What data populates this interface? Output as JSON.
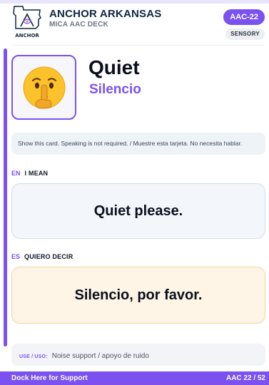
{
  "header": {
    "brand": "ANCHOR ARKANSAS",
    "deck": "MICA AAC DECK",
    "card_code": "AAC-22",
    "category": "SENSORY",
    "logo_text": "ANCHOR"
  },
  "card": {
    "emoji_icon": "shushing-face-icon",
    "title_en": "Quiet",
    "title_es": "Silencio",
    "instruction": "Show this card. Speaking is not required. / Muestre esta tarjeta. No necesita hablar."
  },
  "english": {
    "code": "EN",
    "heading": "I MEAN",
    "phrase": "Quiet please."
  },
  "spanish": {
    "code": "ES",
    "heading": "QUIERO DECIR",
    "phrase": "Silencio, por favor."
  },
  "use": {
    "label": "USE / USO:",
    "text": "Noise support / apoyo de ruido"
  },
  "footer": {
    "left": "Dock Here for Support",
    "right": "AAC 22 / 52"
  },
  "colors": {
    "accent": "#7b52f0",
    "navy": "#0f2742",
    "english_panel": "#f3f7fb",
    "spanish_panel": "#fef5e6"
  }
}
